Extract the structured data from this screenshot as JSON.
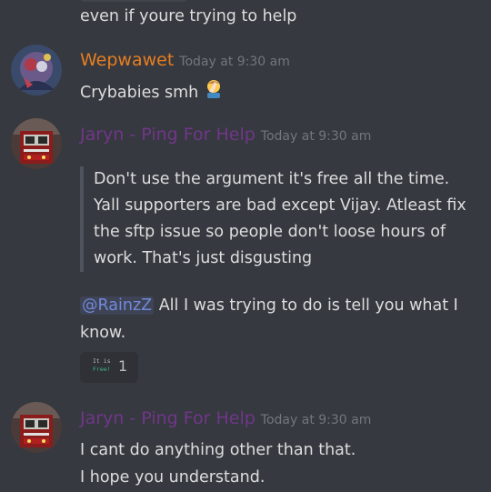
{
  "prev_message": {
    "text": "even if youre trying to help"
  },
  "messages": [
    {
      "username": "Wepwawet",
      "username_color": "#e67e22",
      "timestamp": "Today at 9:30 am",
      "lines": [
        "Crybabies smh"
      ],
      "emoji": "man-facepalming-emoji"
    },
    {
      "username": "Jaryn - Ping For Help",
      "username_color": "#71368a",
      "timestamp": "Today at 9:30 am",
      "quote": [
        "Don't use the argument it's free all the time.",
        "Yall supporters are bad except Vijay. Atleast fix",
        "the sftp issue so people don't loose hours of",
        "work. That's just disgusting"
      ],
      "mention": "@RainzZ",
      "reply_lines": [
        " All I was trying to do is tell you what I",
        "know."
      ],
      "reaction": {
        "emoji_text_top": "It is",
        "emoji_text_bottom": "Free!",
        "count": "1"
      }
    },
    {
      "username": "Jaryn - Ping For Help",
      "username_color": "#71368a",
      "timestamp": "Today at 9:30 am",
      "lines": [
        "I cant do anything other than that.",
        "I hope you understand."
      ]
    }
  ],
  "colors": {
    "background": "#36393f",
    "text": "#dcddde",
    "timestamp": "#72767d",
    "mention": "#7289da"
  }
}
